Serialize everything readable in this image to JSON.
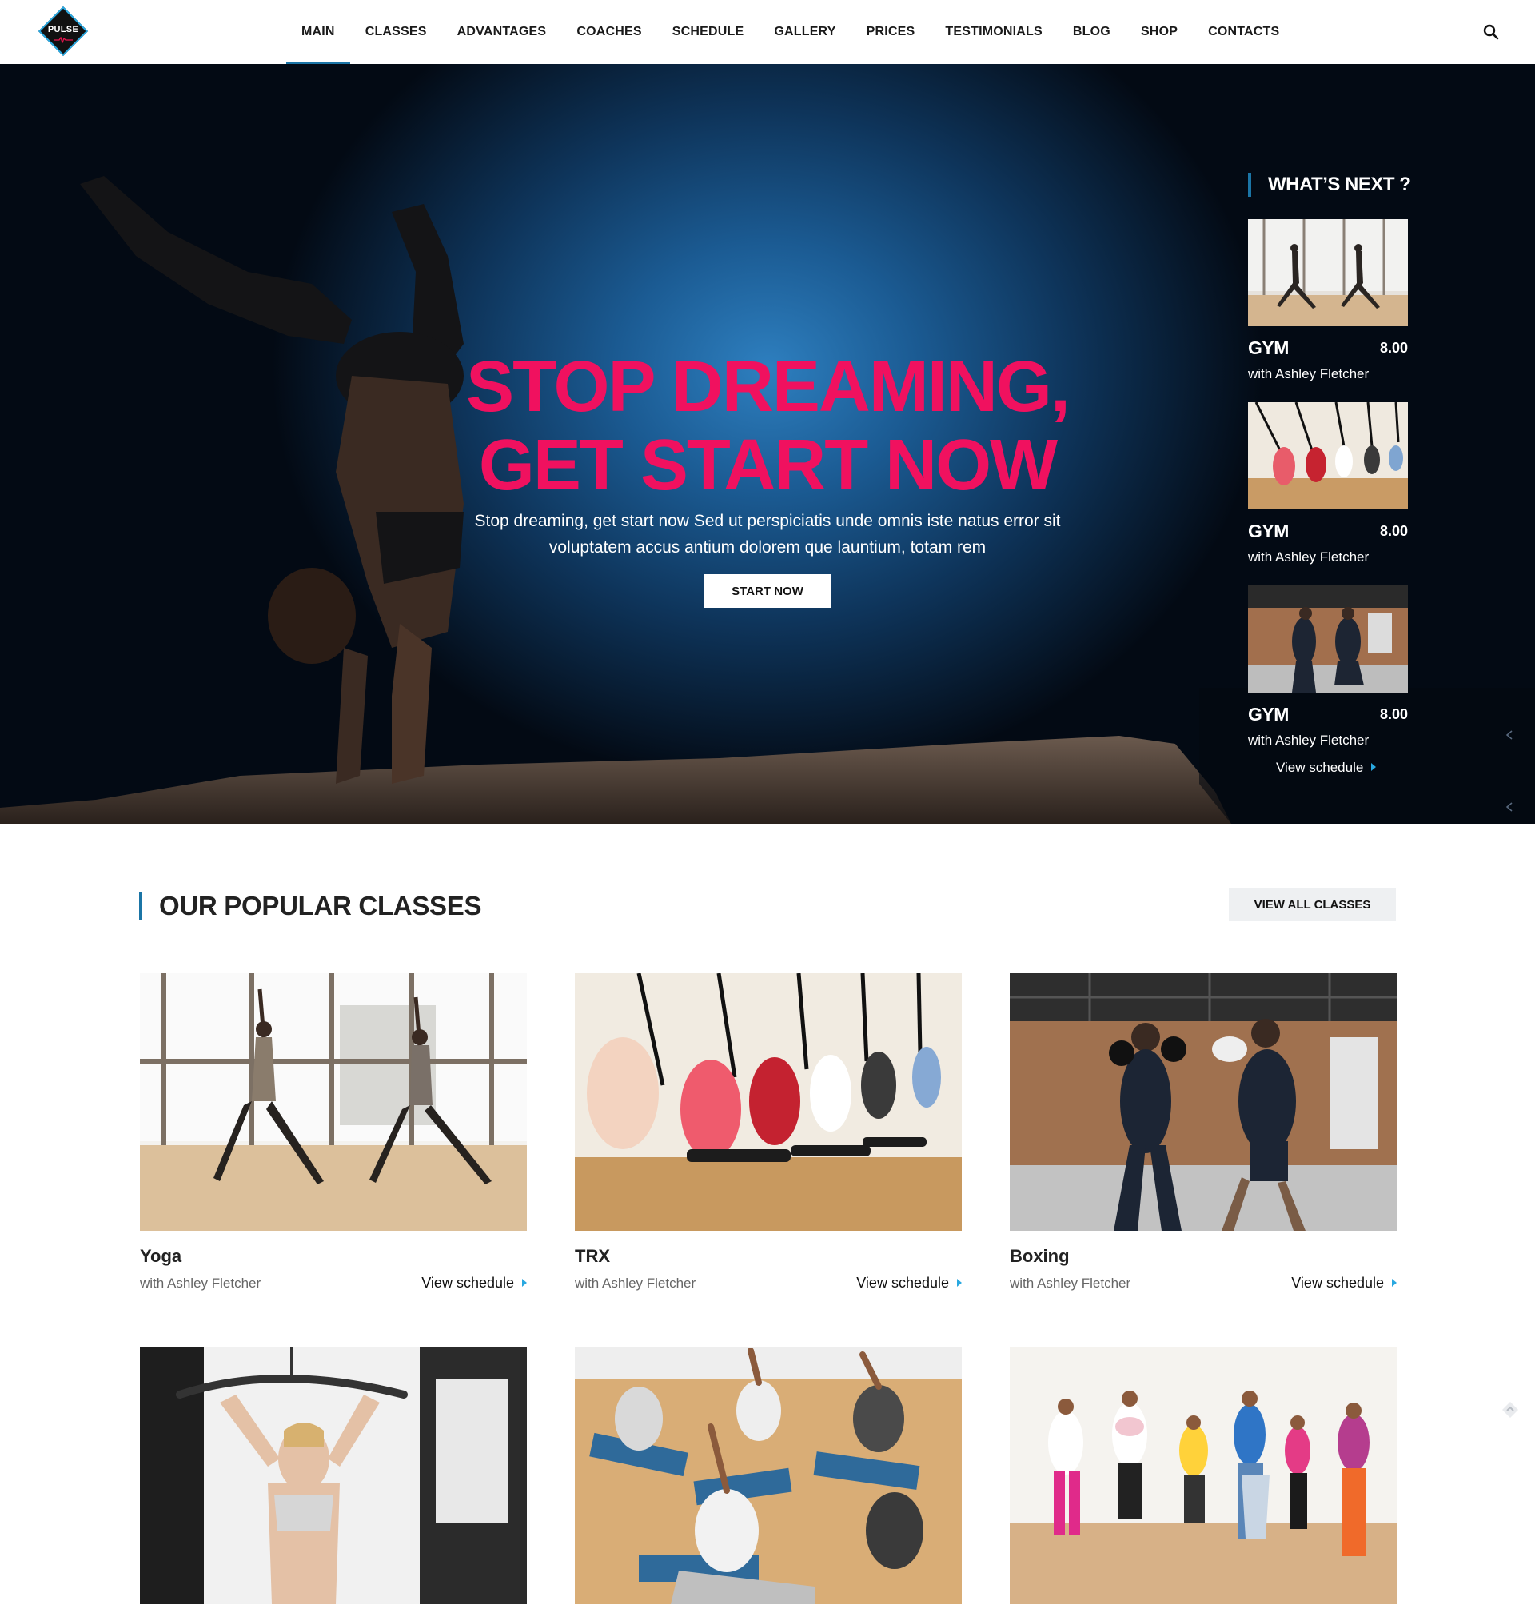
{
  "header": {
    "logo_text": "PULSE",
    "nav": [
      {
        "label": "MAIN",
        "active": true
      },
      {
        "label": "CLASSES"
      },
      {
        "label": "ADVANTAGES"
      },
      {
        "label": "COACHES"
      },
      {
        "label": "SCHEDULE"
      },
      {
        "label": "GALLERY"
      },
      {
        "label": "PRICES"
      },
      {
        "label": "TESTIMONIALS"
      },
      {
        "label": "BLOG"
      },
      {
        "label": "SHOP"
      },
      {
        "label": "CONTACTS"
      }
    ],
    "search_icon": "search-icon"
  },
  "hero": {
    "headline_line1": "STOP DREAMING,",
    "headline_line2": "GET START NOW",
    "subtext_line1": "Stop dreaming, get start now Sed ut perspiciatis unde omnis iste natus error sit",
    "subtext_line2": "voluptatem accus antium dolorem que launtium, totam rem",
    "cta_label": "START NOW"
  },
  "whats_next": {
    "title": "WHAT’S NEXT ?",
    "items": [
      {
        "name": "GYM",
        "time": "8.00",
        "coach": "with Ashley Fletcher",
        "image": "yoga-studio"
      },
      {
        "name": "GYM",
        "time": "8.00",
        "coach": "with Ashley Fletcher",
        "image": "trx-group"
      },
      {
        "name": "GYM",
        "time": "8.00",
        "coach": "with Ashley Fletcher",
        "image": "boxing-pads"
      }
    ],
    "link": "View schedule"
  },
  "popular": {
    "title": "OUR POPULAR CLASSES",
    "view_all": "VIEW ALL CLASSES",
    "classes": [
      {
        "name": "Yoga",
        "coach": "with Ashley Fletcher",
        "link": "View schedule",
        "image": "yoga-studio"
      },
      {
        "name": "TRX",
        "coach": "with Ashley Fletcher",
        "link": "View schedule",
        "image": "trx-group"
      },
      {
        "name": "Boxing",
        "coach": "with Ashley Fletcher",
        "link": "View schedule",
        "image": "boxing-pads"
      },
      {
        "name": "",
        "coach": "",
        "link": "",
        "image": "lat-pulldown"
      },
      {
        "name": "",
        "coach": "",
        "link": "",
        "image": "stretching-class"
      },
      {
        "name": "",
        "coach": "",
        "link": "",
        "image": "zumba-dance"
      }
    ]
  },
  "colors": {
    "accent": "#1b75a6",
    "headline": "#f0115f",
    "link_arrow": "#29a8e0"
  }
}
